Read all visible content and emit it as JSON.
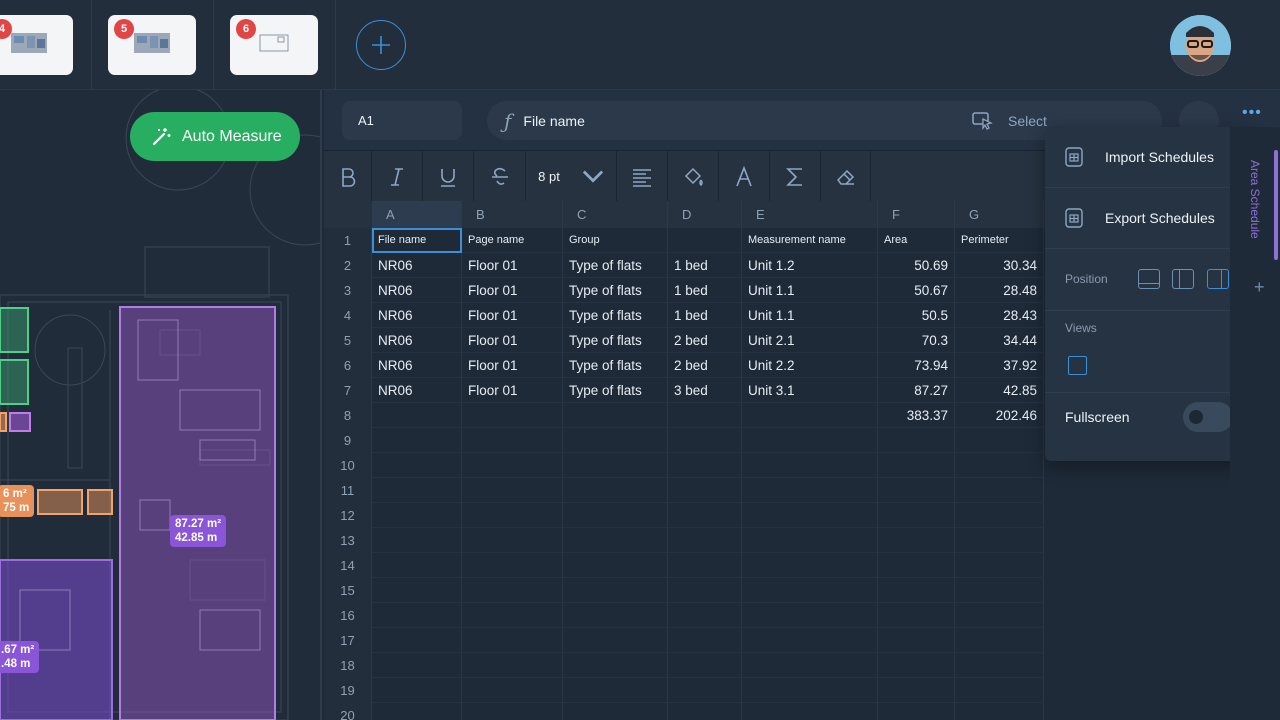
{
  "pages": [
    {
      "badge": "4"
    },
    {
      "badge": "5"
    },
    {
      "badge": "6"
    }
  ],
  "auto_measure_label": "Auto Measure",
  "canvas_labels": [
    {
      "area": "87.27 m²",
      "perimeter": "42.85 m"
    },
    {
      "area": "6 m²",
      "perimeter": "75 m"
    },
    {
      "area": ".67 m²",
      "perimeter": ".48 m"
    }
  ],
  "formula_bar": {
    "cell_ref": "A1",
    "value": "File name",
    "select_label": "Select"
  },
  "toolbar": {
    "font_size": "8 pt"
  },
  "columns": [
    "A",
    "B",
    "C",
    "D",
    "E",
    "F",
    "G"
  ],
  "row_numbers": [
    "1",
    "2",
    "3",
    "4",
    "5",
    "6",
    "7",
    "8",
    "9",
    "10",
    "11",
    "12",
    "13",
    "14",
    "15",
    "16",
    "17",
    "18",
    "19",
    "20"
  ],
  "headers": [
    "File name",
    "Page name",
    "Group",
    "",
    "Measurement name",
    "Area",
    "Perimeter"
  ],
  "rows": [
    [
      "NR06",
      "Floor 01",
      "Type of flats",
      "1 bed",
      "Unit 1.2",
      "50.69",
      "30.34"
    ],
    [
      "NR06",
      "Floor 01",
      "Type of flats",
      "1 bed",
      "Unit 1.1",
      "50.67",
      "28.48"
    ],
    [
      "NR06",
      "Floor 01",
      "Type of flats",
      "1 bed",
      "Unit 1.1",
      "50.5",
      "28.43"
    ],
    [
      "NR06",
      "Floor 01",
      "Type of flats",
      "2 bed",
      "Unit 2.1",
      "70.3",
      "34.44"
    ],
    [
      "NR06",
      "Floor 01",
      "Type of flats",
      "2 bed",
      "Unit 2.2",
      "73.94",
      "37.92"
    ],
    [
      "NR06",
      "Floor 01",
      "Type of flats",
      "3 bed",
      "Unit 3.1",
      "87.27",
      "42.85"
    ]
  ],
  "totals": {
    "area": "383.37",
    "perimeter": "202.46"
  },
  "menu": {
    "import": "Import Schedules",
    "export": "Export Schedules",
    "position": "Position",
    "views": "Views",
    "fullscreen": "Fullscreen"
  },
  "side_tab_label": "Area Schedule",
  "colors": {
    "accent": "#3d8fd6",
    "auto_measure": "#27ae60",
    "purple_zone": "#9b59d0",
    "orange_zone": "#e8915a",
    "badge": "#e04646"
  }
}
